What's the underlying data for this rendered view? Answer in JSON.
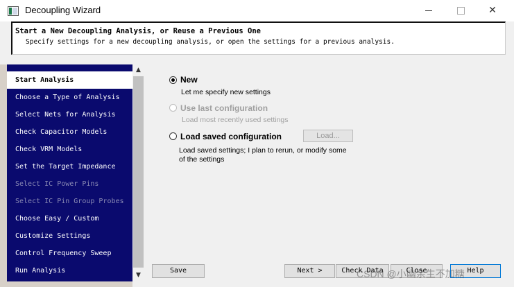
{
  "window": {
    "title": "Decoupling Wizard",
    "minimize_icon": "minimize-icon",
    "maximize_icon": "maximize-icon",
    "close_glyph": "✕"
  },
  "header": {
    "title": "Start a New Decoupling Analysis, or Reuse a Previous One",
    "subtitle": "Specify settings for a new decoupling analysis, or open the settings for a previous analysis."
  },
  "nav": {
    "items": [
      {
        "label": "Start Analysis",
        "state": "active"
      },
      {
        "label": "Choose a Type of Analysis",
        "state": "enabled"
      },
      {
        "label": "Select Nets for Analysis",
        "state": "enabled"
      },
      {
        "label": "Check Capacitor Models",
        "state": "enabled"
      },
      {
        "label": "Check VRM Models",
        "state": "enabled"
      },
      {
        "label": "Set the Target Impedance",
        "state": "enabled"
      },
      {
        "label": "Select IC Power Pins",
        "state": "disabled"
      },
      {
        "label": "Select IC Pin Group Probes",
        "state": "disabled"
      },
      {
        "label": "Choose Easy / Custom",
        "state": "enabled"
      },
      {
        "label": "Customize Settings",
        "state": "enabled"
      },
      {
        "label": "Control Frequency Sweep",
        "state": "enabled"
      },
      {
        "label": "Run Analysis",
        "state": "enabled"
      }
    ]
  },
  "scrollbar": {
    "up_glyph": "▲",
    "down_glyph": "▼"
  },
  "options": {
    "new": {
      "label": "New",
      "desc": "Let me specify new settings",
      "checked": true,
      "enabled": true
    },
    "last": {
      "label": "Use last configuration",
      "desc": "Load most recently used settings",
      "checked": false,
      "enabled": false
    },
    "saved": {
      "label": "Load saved configuration",
      "desc": "Load saved settings; I plan to rerun, or modify some of the settings",
      "checked": false,
      "enabled": true
    },
    "load_button": "Load..."
  },
  "buttons": {
    "save": "Save",
    "next": "Next >",
    "check_data": "Check Data",
    "close": "Close",
    "help": "Help"
  },
  "watermark": "CSDN @小幽余生不加糖"
}
